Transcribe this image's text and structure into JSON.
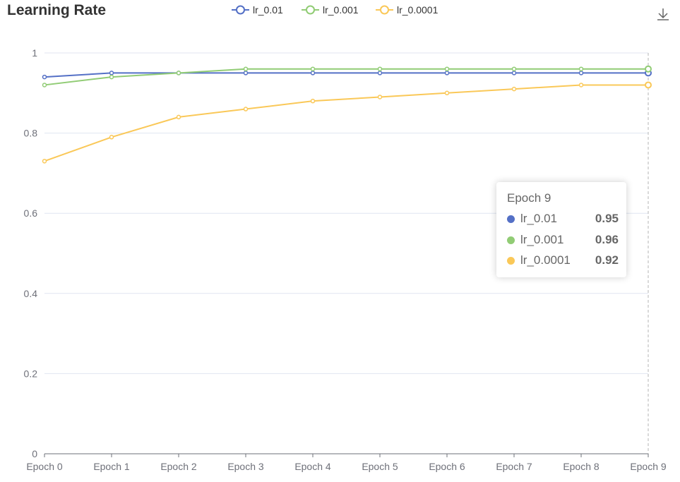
{
  "header": {
    "title": "Learning Rate",
    "download_icon": "download-icon"
  },
  "colors": {
    "lr_0.01": "#5470c6",
    "lr_0.001": "#91cc75",
    "lr_0.0001": "#fac858",
    "grid": "#e0e6f1",
    "axis": "#6e7079"
  },
  "chart_data": {
    "type": "line",
    "title": "Learning Rate",
    "categories": [
      "Epoch 0",
      "Epoch 1",
      "Epoch 2",
      "Epoch 3",
      "Epoch 4",
      "Epoch 5",
      "Epoch 6",
      "Epoch 7",
      "Epoch 8",
      "Epoch 9"
    ],
    "series": [
      {
        "name": "lr_0.01",
        "values": [
          0.94,
          0.95,
          0.95,
          0.95,
          0.95,
          0.95,
          0.95,
          0.95,
          0.95,
          0.95
        ]
      },
      {
        "name": "lr_0.001",
        "values": [
          0.92,
          0.94,
          0.95,
          0.96,
          0.96,
          0.96,
          0.96,
          0.96,
          0.96,
          0.96
        ]
      },
      {
        "name": "lr_0.0001",
        "values": [
          0.73,
          0.79,
          0.84,
          0.86,
          0.88,
          0.89,
          0.9,
          0.91,
          0.92,
          0.92
        ]
      }
    ],
    "yticks": [
      "0",
      "0.2",
      "0.4",
      "0.6",
      "0.8",
      "1"
    ],
    "ylim": [
      0,
      1
    ],
    "grid": true,
    "legend": "top-center",
    "xlabel": "",
    "ylabel": ""
  },
  "tooltip": {
    "title": "Epoch 9",
    "rows": [
      {
        "name": "lr_0.01",
        "value": "0.95"
      },
      {
        "name": "lr_0.001",
        "value": "0.96"
      },
      {
        "name": "lr_0.0001",
        "value": "0.92"
      }
    ]
  }
}
